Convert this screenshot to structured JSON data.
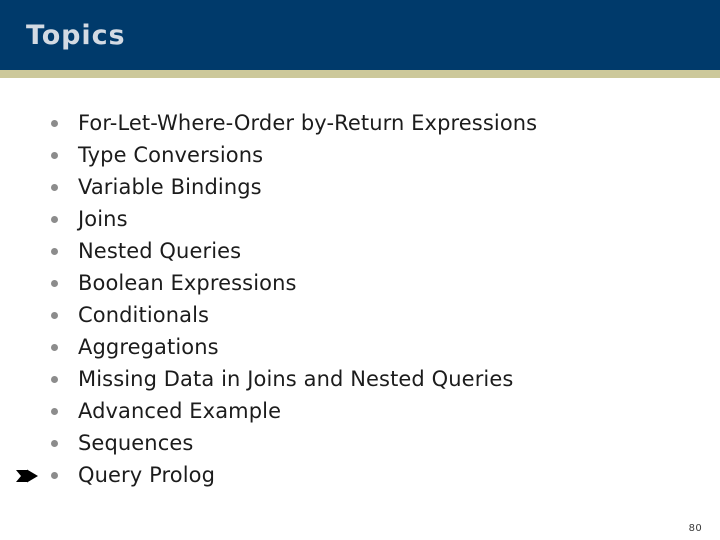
{
  "slide": {
    "title": "Topics",
    "page_number": "80",
    "colors": {
      "header_background": "#003a6b",
      "header_title_text": "#d3dae3",
      "accent_rule": "#ccc89a",
      "body_background": "#ffffff",
      "bullet_marker": "#8c8c8c",
      "body_text": "#1c1c1c",
      "pointer_marker": "#000000"
    },
    "bullets": [
      {
        "label": "For-Let-Where-Order by-Return Expressions",
        "marked": false
      },
      {
        "label": "Type Conversions",
        "marked": false
      },
      {
        "label": "Variable Bindings",
        "marked": false
      },
      {
        "label": "Joins",
        "marked": false
      },
      {
        "label": "Nested Queries",
        "marked": false
      },
      {
        "label": "Boolean Expressions",
        "marked": false
      },
      {
        "label": "Conditionals",
        "marked": false
      },
      {
        "label": "Aggregations",
        "marked": false
      },
      {
        "label": "Missing Data in Joins and Nested Queries",
        "marked": false
      },
      {
        "label": "Advanced Example",
        "marked": false
      },
      {
        "label": "Sequences",
        "marked": false
      },
      {
        "label": "Query Prolog",
        "marked": true
      }
    ],
    "icons": {
      "pointer": "right-arrow-marker-icon",
      "bullet": "bullet-dot-icon"
    }
  }
}
